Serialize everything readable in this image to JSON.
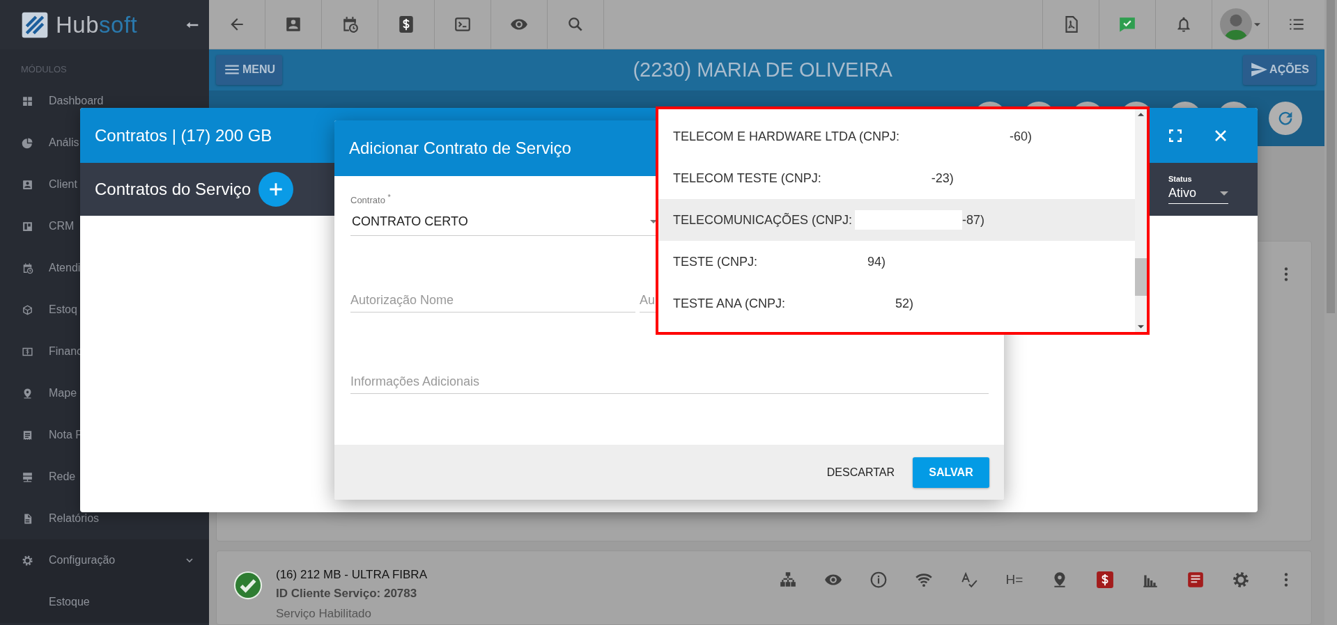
{
  "sidebar": {
    "logo_text": "Hub",
    "logo_accent": "soft",
    "section": "MÓDULOS",
    "items": [
      {
        "label": "Dashboard"
      },
      {
        "label": "Anális"
      },
      {
        "label": "Client"
      },
      {
        "label": "CRM"
      },
      {
        "label": "Atendi"
      },
      {
        "label": "Estoq"
      },
      {
        "label": "Financ"
      },
      {
        "label": "Mape"
      },
      {
        "label": "Nota F"
      },
      {
        "label": "Rede"
      },
      {
        "label": "Relatórios"
      },
      {
        "label": "Configuração",
        "expanded": true,
        "children": [
          {
            "label": "Estoque"
          }
        ]
      }
    ]
  },
  "page": {
    "menu_button": "MENU",
    "title": "(2230) MARIA DE OLIVEIRA",
    "actions_button": "AÇÕES"
  },
  "service_card": {
    "title": "(16) 212 MB - ULTRA FIBRA",
    "id_line": "ID Cliente Serviço: 20783",
    "status": "Serviço Habilitado",
    "heading_tool": "H="
  },
  "contracts_modal": {
    "title": "Contratos | (17) 200 GB",
    "subtitle": "Contratos do Serviço",
    "status_label": "Status",
    "status_value": "Ativo"
  },
  "add_contract_dialog": {
    "title": "Adicionar Contrato de Serviço",
    "fields": [
      {
        "kind": "select",
        "label": "Contrato $^{*}$",
        "value": "CONTRATO CERTO"
      },
      {
        "kind": "text",
        "placeholder": "Autorização Nome"
      },
      {
        "kind": "text",
        "placeholder": "Au"
      },
      {
        "kind": "textarea",
        "placeholder": "Informações Adicionais"
      }
    ],
    "cancel_button": "DESCARTAR",
    "save_button": "SALVAR"
  },
  "dropdown": {
    "options": [
      {
        "label": "TELECOM E HARDWARE LTDA (CNPJ:",
        "suffix": "-60)",
        "selected": false
      },
      {
        "label": "TELECOM TESTE (CNPJ:",
        "suffix": "-23)",
        "selected": false
      },
      {
        "label": "TELECOMUNICAÇÕES (CNPJ:",
        "suffix": "-87)",
        "selected": true
      },
      {
        "label": "TESTE (CNPJ:",
        "suffix": "94)",
        "selected": false
      },
      {
        "label": "TESTE ANA (CNPJ:",
        "suffix": "52)",
        "selected": false
      }
    ]
  }
}
